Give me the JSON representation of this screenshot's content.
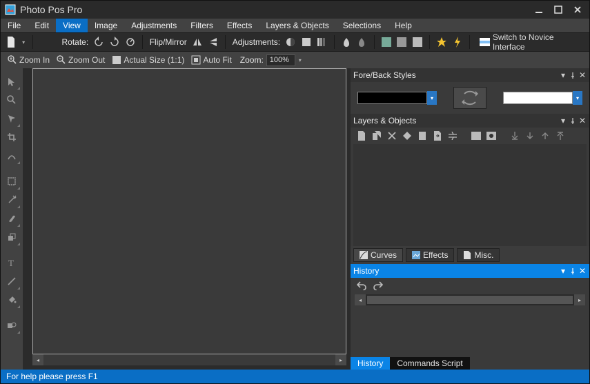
{
  "title": "Photo Pos Pro",
  "menubar": [
    "File",
    "Edit",
    "View",
    "Image",
    "Adjustments",
    "Filters",
    "Effects",
    "Layers & Objects",
    "Selections",
    "Help"
  ],
  "menubar_highlight": 2,
  "toolbar1": {
    "rotate": "Rotate:",
    "flip": "Flip/Mirror",
    "adjust": "Adjustments:",
    "novice": "Switch to Novice Interface"
  },
  "toolbar2": {
    "zoom_in": "Zoom In",
    "zoom_out": "Zoom Out",
    "actual": "Actual Size (1:1)",
    "autofit": "Auto Fit",
    "zoom_label": "Zoom:",
    "zoom_value": "100%"
  },
  "panels": {
    "fore": "Fore/Back Styles",
    "layers": "Layers & Objects",
    "history": "History",
    "tabs": {
      "curves": "Curves",
      "effects": "Effects",
      "misc": "Misc."
    },
    "history_tabs": {
      "history": "History",
      "commands": "Commands Script"
    }
  },
  "status": "For help please press F1"
}
